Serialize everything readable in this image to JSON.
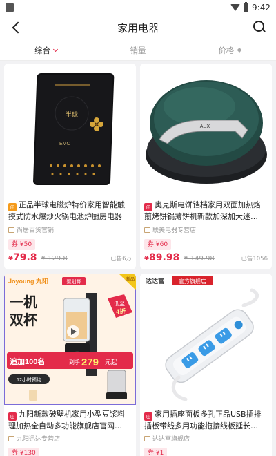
{
  "status": {
    "time": "9:42"
  },
  "header": {
    "title": "家用电器"
  },
  "sort": [
    {
      "label": "综合"
    },
    {
      "label": "销量"
    },
    {
      "label": "价格"
    }
  ],
  "products": [
    {
      "title": "正品半球电磁炉特价家用智能触摸式防水爆炒火锅电池炉厨房电器",
      "shop": "尚居百货官销",
      "coupon": "券 ¥50",
      "price": "79.8",
      "original": "¥ 129.8",
      "sold": "已售6万",
      "brand_text": "半球"
    },
    {
      "title": "奥克斯电饼铛档家用双面加热烙煎烤饼锅薄饼机新款加深加大迷…",
      "shop": "联美电器专营店",
      "coupon": "券 ¥60",
      "price": "89.98",
      "original": "¥ 149.98",
      "sold": "已售1056",
      "brand_text": "AUX"
    },
    {
      "title": "九阳新款破壁机家用小型豆浆料理加热全自动多功能旗舰店官网…",
      "shop": "九阳迅达专营店",
      "coupon": "券 ¥130",
      "banner": {
        "brand": "Joyoung 九阳",
        "promo": "聚划算",
        "badge": "新品",
        "big1": "一机",
        "big2": "双杯",
        "down1": "低至",
        "down2": "4折",
        "add": "追加100名",
        "price_prefix": "到手",
        "price": "279",
        "price_suffix": "元起",
        "timer": "12小时预约"
      }
    },
    {
      "title": "家用插座面板多孔正品USB插排插板带线多用功能拖接线板延长…",
      "shop": "达达富旗舰店",
      "coupon": "券 ¥1",
      "banner": {
        "brand": "达达富",
        "flag": "官方旗舰店"
      }
    }
  ]
}
